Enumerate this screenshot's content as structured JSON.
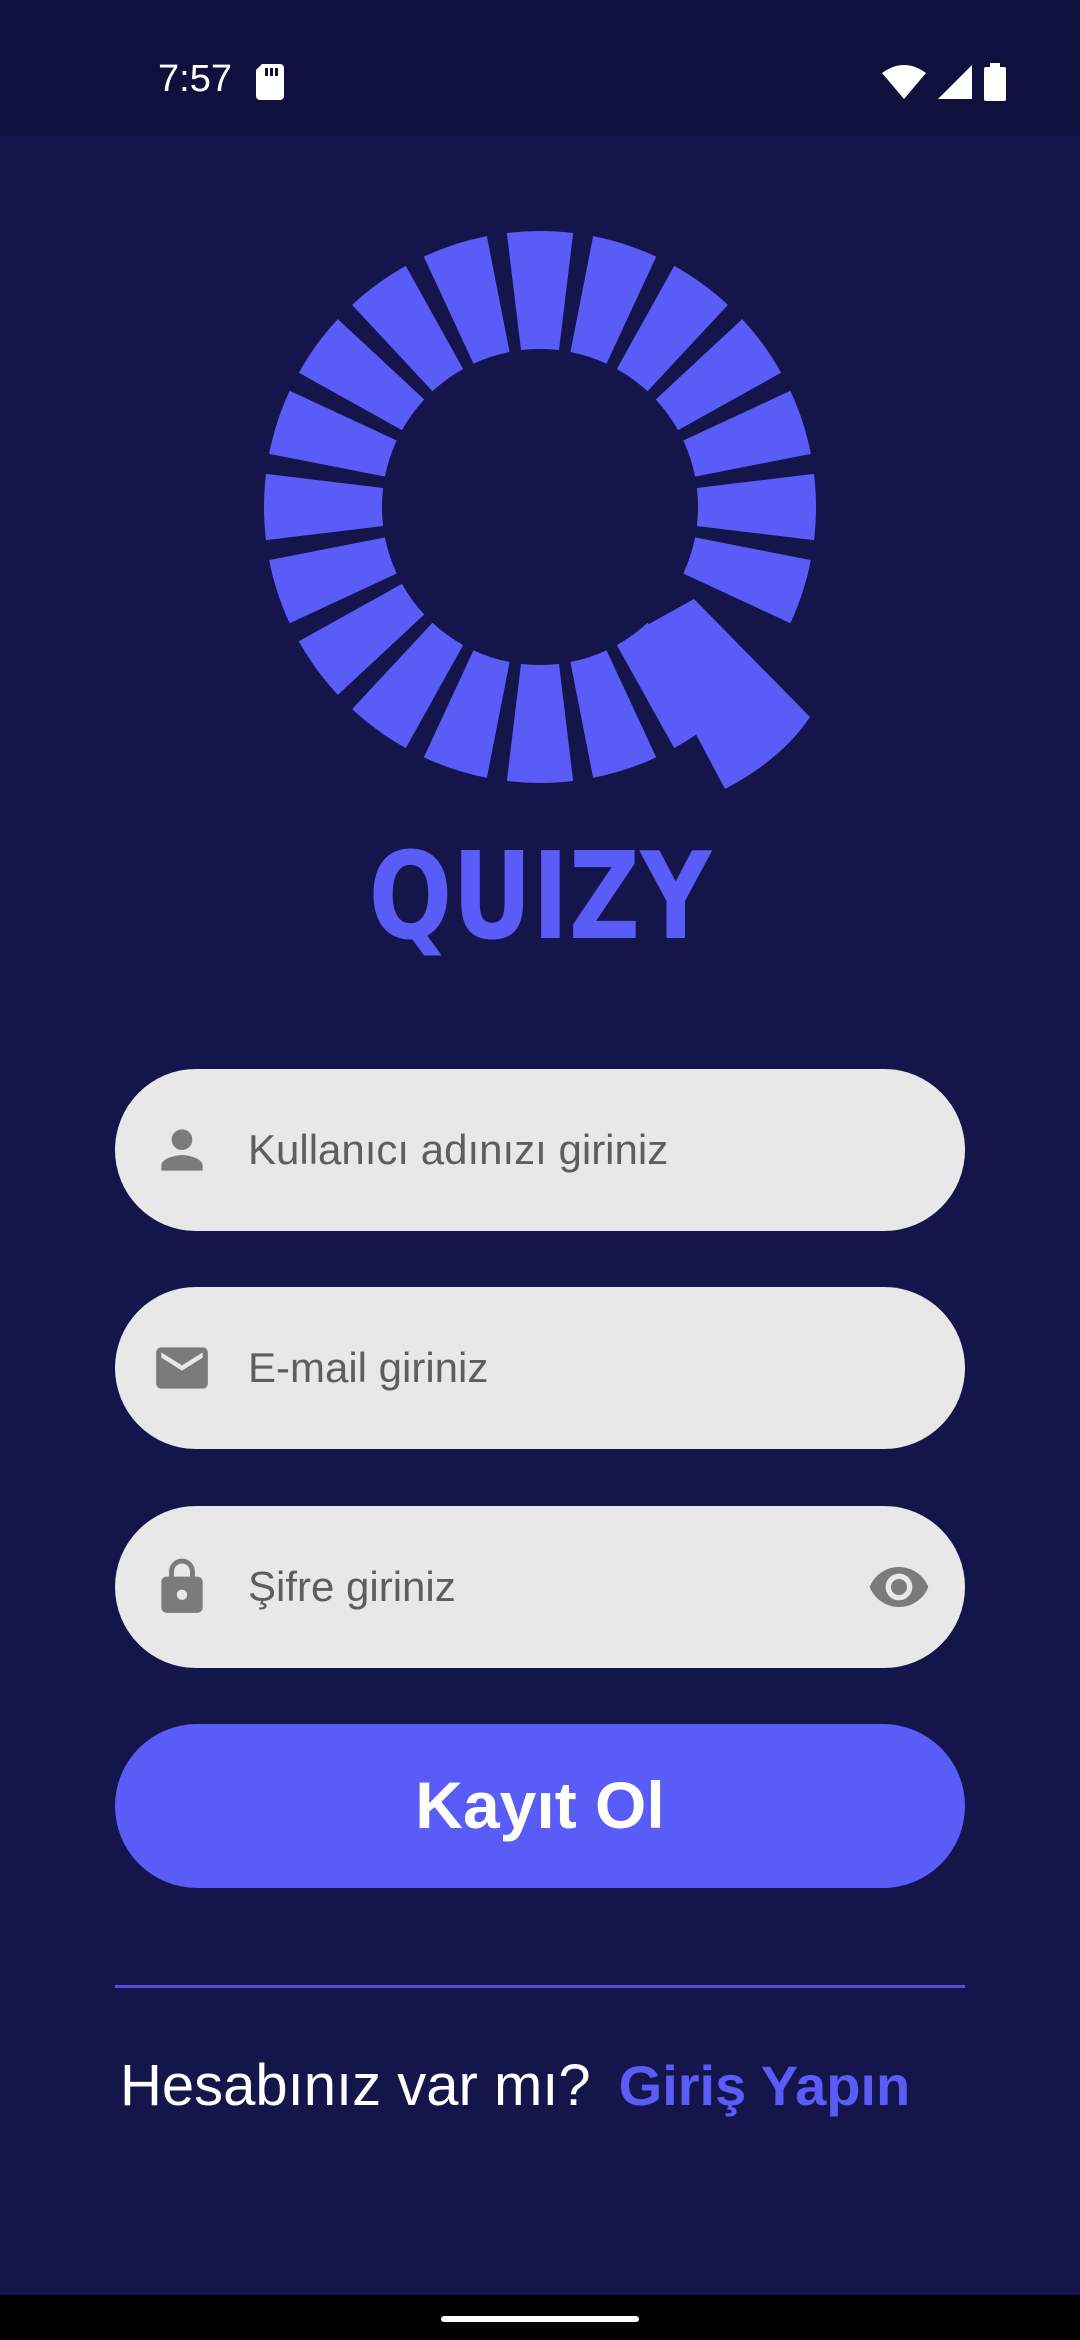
{
  "status_bar": {
    "time": "7:57",
    "icons": [
      "sd-card-icon",
      "wifi-icon",
      "cell-signal-icon",
      "battery-icon"
    ]
  },
  "app": {
    "brand_name": "QUIZY",
    "logo": "quizy-q-logo",
    "accent_color": "#5a5cf8",
    "background_color": "#14154a"
  },
  "form": {
    "username": {
      "placeholder": "Kullanıcı adınızı giriniz",
      "icon": "person-icon"
    },
    "email": {
      "placeholder": "E-mail giriniz",
      "icon": "mail-icon"
    },
    "password": {
      "placeholder": "Şifre giriniz",
      "icon": "lock-icon",
      "toggle_icon": "eye-icon"
    },
    "submit_label": "Kayıt Ol"
  },
  "footer": {
    "question": "Hesabınız var mı?",
    "link_label": "Giriş Yapın"
  }
}
